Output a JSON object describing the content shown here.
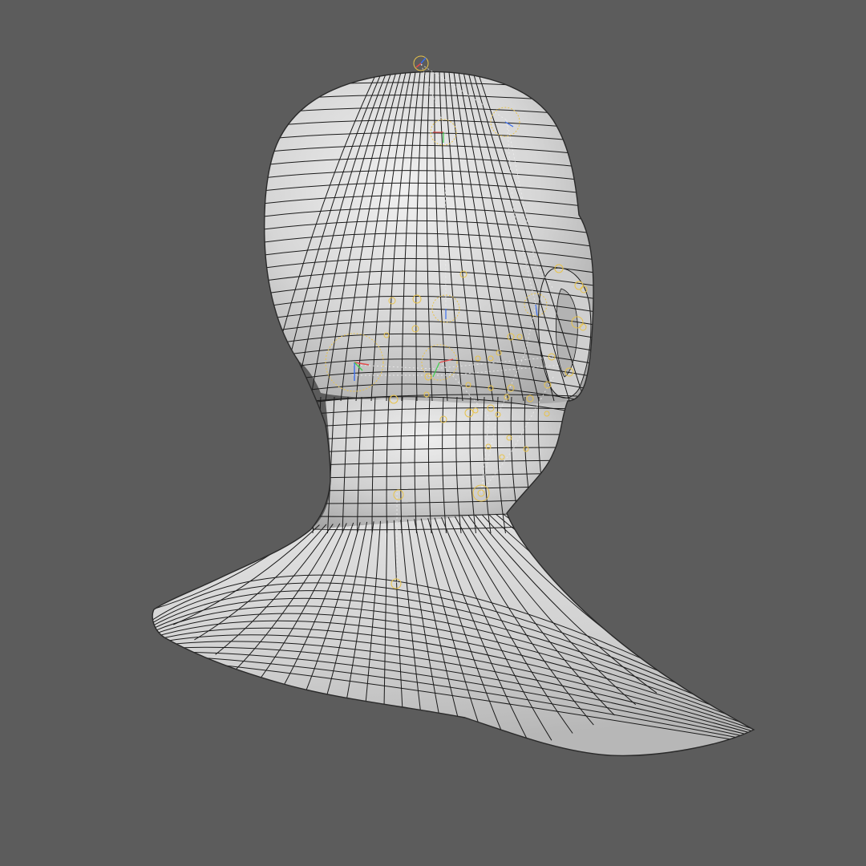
{
  "viewport": {
    "background_color": "#5c5c5c",
    "mesh_fill_color": "#d8d8d8",
    "mesh_highlight_color": "#f2f2f2",
    "mesh_wire_color": "#1a1a1a",
    "rig_control_color": "#e8c34a",
    "rig_guide_color": "#eeeeee",
    "axis_colors": {
      "x": "#e24a4a",
      "y": "#3fcf4f",
      "z": "#3a6ff0"
    },
    "object": "head-and-shoulders-bust-mesh",
    "view": "back-three-quarter",
    "shading": "smooth-shaded-with-wireframe"
  }
}
